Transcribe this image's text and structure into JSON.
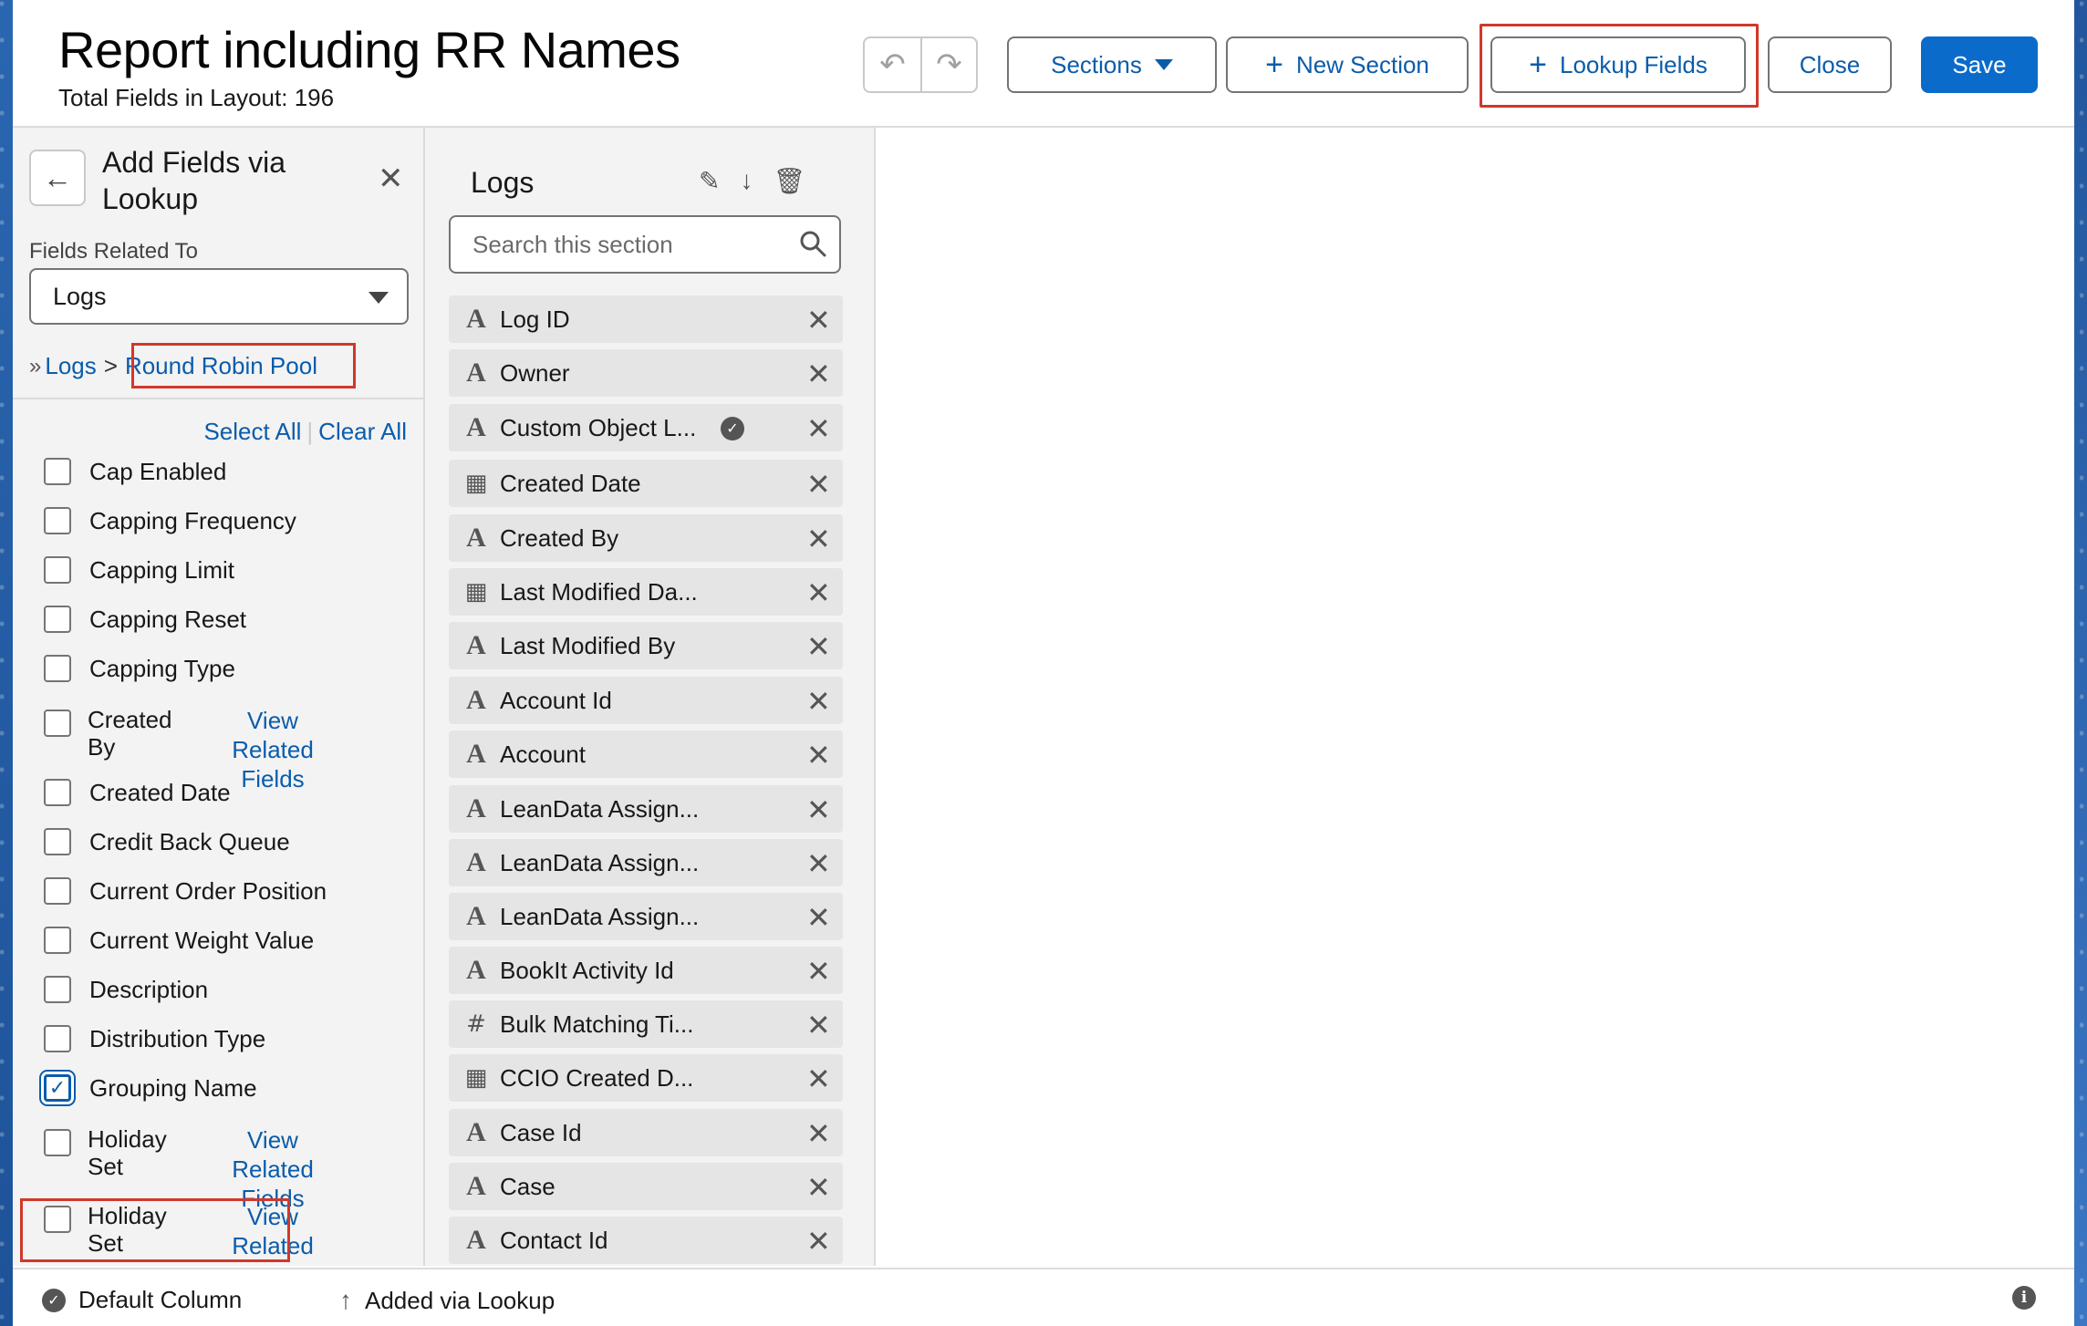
{
  "header": {
    "title": "Report including RR Names",
    "subtitle": "Total Fields in Layout: 196",
    "sections_label": "Sections",
    "new_section_label": "New Section",
    "lookup_fields_label": "Lookup Fields",
    "close_label": "Close",
    "save_label": "Save"
  },
  "left_panel": {
    "title": "Add Fields via Lookup",
    "related_label": "Fields Related To",
    "related_value": "Logs",
    "breadcrumb": [
      "Logs",
      "Round Robin Pool"
    ],
    "select_all": "Select All",
    "clear_all": "Clear All",
    "view_related": "View Related Fields",
    "items": [
      {
        "label": "Cap Enabled",
        "checked": false
      },
      {
        "label": "Capping Frequency",
        "checked": false
      },
      {
        "label": "Capping Limit",
        "checked": false
      },
      {
        "label": "Capping Reset",
        "checked": false
      },
      {
        "label": "Capping Type",
        "checked": false
      },
      {
        "label": "Created By",
        "checked": false
      },
      {
        "label": "Created Date",
        "checked": false
      },
      {
        "label": "Credit Back Queue",
        "checked": false
      },
      {
        "label": "Current Order Position",
        "checked": false
      },
      {
        "label": "Current Weight Value",
        "checked": false
      },
      {
        "label": "Description",
        "checked": false
      },
      {
        "label": "Distribution Type",
        "checked": false
      },
      {
        "label": "Grouping Name",
        "checked": true
      },
      {
        "label": "Holiday Set",
        "checked": false
      },
      {
        "label": "Holiday Set",
        "checked": false
      }
    ]
  },
  "mid_panel": {
    "section_title": "Logs",
    "search_placeholder": "Search this section",
    "fields": [
      {
        "name": "Log ID",
        "icon": "text-icon"
      },
      {
        "name": "Owner",
        "icon": "text-icon"
      },
      {
        "name": "Custom Object L...",
        "icon": "text-icon",
        "default": true
      },
      {
        "name": "Created Date",
        "icon": "calendar-icon"
      },
      {
        "name": "Created By",
        "icon": "text-icon"
      },
      {
        "name": "Last Modified Da...",
        "icon": "calendar-icon"
      },
      {
        "name": "Last Modified By",
        "icon": "text-icon"
      },
      {
        "name": "Account Id",
        "icon": "text-icon"
      },
      {
        "name": "Account",
        "icon": "text-icon"
      },
      {
        "name": "LeanData Assign...",
        "icon": "text-icon"
      },
      {
        "name": "LeanData Assign...",
        "icon": "text-icon"
      },
      {
        "name": "LeanData Assign...",
        "icon": "text-icon"
      },
      {
        "name": "BookIt Activity Id",
        "icon": "text-icon"
      },
      {
        "name": "Bulk Matching Ti...",
        "icon": "number-icon"
      },
      {
        "name": "CCIO Created D...",
        "icon": "calendar-icon"
      },
      {
        "name": "Case Id",
        "icon": "text-icon"
      },
      {
        "name": "Case",
        "icon": "text-icon"
      },
      {
        "name": "Contact Id",
        "icon": "text-icon"
      }
    ]
  },
  "footer": {
    "default_column": "Default Column",
    "added_via_lookup": "Added via Lookup"
  }
}
